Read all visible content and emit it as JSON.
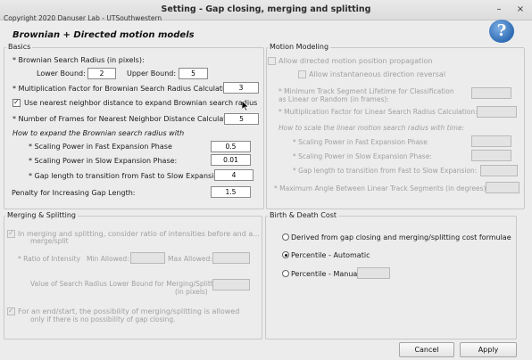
{
  "window": {
    "title": "Setting - Gap closing, merging and splitting",
    "copyright": "Copyright 2020 Danuser Lab - UTSouthwestern",
    "heading": "Brownian + Directed motion models",
    "help_glyph": "?",
    "minimize_glyph": "–",
    "close_glyph": "×"
  },
  "basics": {
    "legend": "Basics",
    "search_radius_label": "* Brownian Search Radius (in pixels):",
    "lower_label": "Lower Bound:",
    "lower_value": "2",
    "upper_label": "Upper Bound:",
    "upper_value": "5",
    "mult_factor_label": "* Multiplication Factor for Brownian Search Radius Calculation:",
    "mult_factor_value": "3",
    "nearest_neighbor_label": "Use nearest neighbor distance to expand Brownian search radius",
    "nearest_neighbor_checked": true,
    "num_frames_label": "* Number of Frames for Nearest Neighbor Distance Calculation:",
    "num_frames_value": "5",
    "expand_heading": "How to expand the Brownian search radius with",
    "fast_label": "* Scaling Power in Fast Expansion Phase",
    "fast_value": "0.5",
    "slow_label": "* Scaling Power in Slow Expansion Phase:",
    "slow_value": "0.01",
    "gap_transition_label": "* Gap length to transition from Fast to Slow Expansion:",
    "gap_transition_value": "4",
    "penalty_label": "Penalty for Increasing Gap Length:",
    "penalty_value": "1.5"
  },
  "motion": {
    "legend": "Motion Modeling",
    "allow_directed_label": "Allow directed motion position propagation",
    "allow_instant_label": "Allow instantaneous direction reversal",
    "min_lifetime_label_1": "* Minimum Track Segment Lifetime for Classification",
    "min_lifetime_label_2": "as Linear or Random (in frames):",
    "linear_mult_label": "* Multiplication Factor for Linear Search Radius Calculation:",
    "linear_heading": "How to scale the linear motion search radius with time:",
    "fast_label": "* Scaling Power in Fast Expansion Phase",
    "slow_label": "* Scaling Power in Slow Expansion Phase:",
    "gap_label": "* Gap length to transition from Fast to Slow Expansion:",
    "max_angle_label": "* Maximum Angle Between Linear Track Segments (in degrees):"
  },
  "merging": {
    "legend": "Merging & Splitting",
    "ratio_check_label_1": "In merging and splitting, consider ratio of intensities before and a...",
    "ratio_check_label_2": "merge/split",
    "ratio_label": "* Ratio of Intensity",
    "min_allowed_label": "Min Allowed:",
    "max_allowed_label": "Max Allowed:",
    "search_lower_label_1": "Value of Search Radius Lower Bound for Merging/Splitti",
    "search_lower_label_2": "(in pixels)",
    "end_start_label_1": "For an end/start, the possibility of merging/splitting is allowed",
    "end_start_label_2": "only if there is no possibility of gap closing."
  },
  "birth_death": {
    "legend": "Birth & Death Cost",
    "options": [
      "Derived from gap closing and merging/splitting cost formulae",
      "Percentile - Automatic",
      "Percentile - Manual"
    ],
    "selected": "Percentile - Automatic"
  },
  "footer": {
    "cancel_label": "Cancel",
    "apply_label": "Apply"
  }
}
